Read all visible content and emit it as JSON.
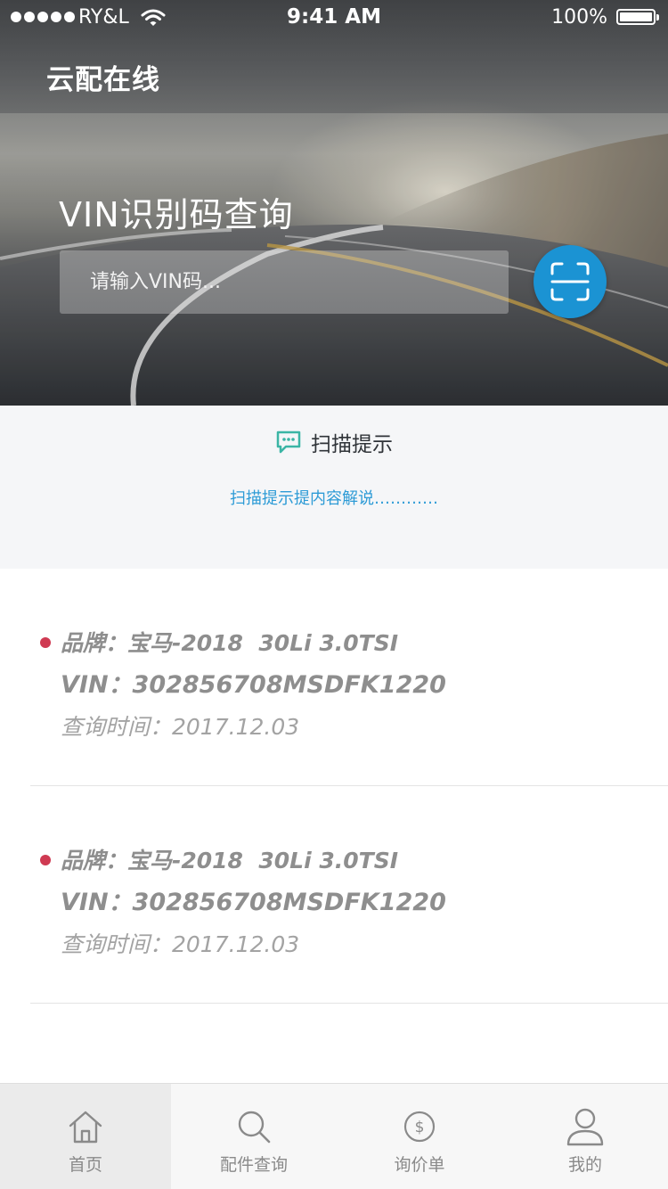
{
  "status_bar": {
    "carrier": "RY&L",
    "time": "9:41 AM",
    "battery": "100%"
  },
  "header": {
    "title": "云配在线"
  },
  "vin_search": {
    "heading": "VIN识别码查询",
    "placeholder": "请输入VIN码...",
    "scan_icon": "scan-frame-icon",
    "accent_color": "#1b93d3"
  },
  "scan_tips": {
    "icon": "chat-bubble-icon",
    "title": "扫描提示",
    "description": "扫描提示提内容解说…………",
    "link_color": "#2d9bd6"
  },
  "history": {
    "dot_color": "#cf3a52",
    "items": [
      {
        "brand": "品牌：宝马-2018  30Li 3.0TSI",
        "vin": "VIN：302856708MSDFK1220",
        "time": "查询时间：2017.12.03"
      },
      {
        "brand": "品牌：宝马-2018  30Li 3.0TSI",
        "vin": "VIN：302856708MSDFK1220",
        "time": "查询时间：2017.12.03"
      }
    ]
  },
  "tab_bar": {
    "tabs": [
      {
        "label": "首页",
        "icon": "home-icon",
        "active": true
      },
      {
        "label": "配件查询",
        "icon": "search-icon",
        "active": false
      },
      {
        "label": "询价单",
        "icon": "dollar-coin-icon",
        "active": false
      },
      {
        "label": "我的",
        "icon": "user-icon",
        "active": false
      }
    ]
  }
}
